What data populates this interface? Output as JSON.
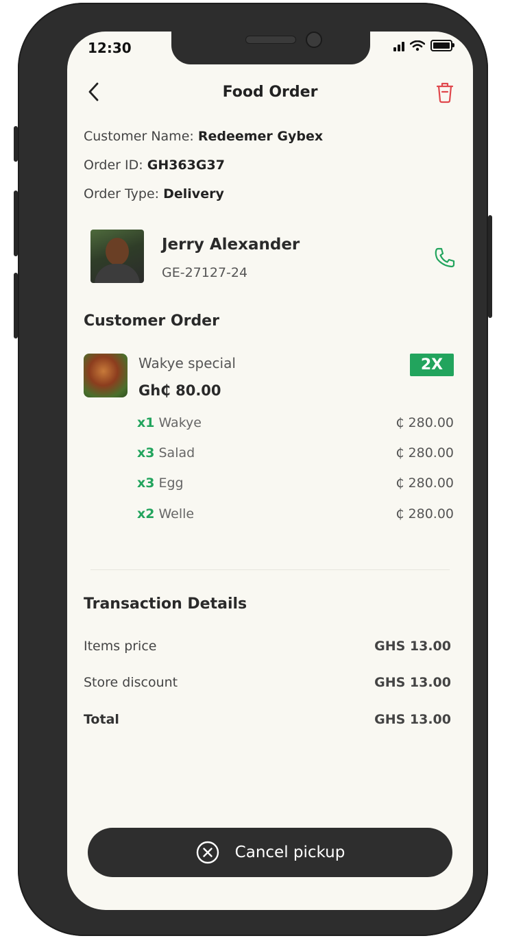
{
  "status_bar": {
    "time": "12:30"
  },
  "header": {
    "title": "Food Order"
  },
  "order_info": {
    "customer_name_label": "Customer Name:",
    "customer_name": "Redeemer Gybex",
    "order_id_label": "Order ID:",
    "order_id": "GH363G37",
    "order_type_label": "Order Type:",
    "order_type": "Delivery"
  },
  "driver": {
    "name": "Jerry Alexander",
    "plate": "GE-27127-24"
  },
  "customer_order": {
    "title": "Customer Order",
    "product": {
      "name": "Wakye special",
      "price": "Gh₵ 80.00",
      "quantity": "2X"
    },
    "items": [
      {
        "qty": "x1",
        "name": "Wakye",
        "price": "₵ 280.00"
      },
      {
        "qty": "x3",
        "name": "Salad",
        "price": "₵ 280.00"
      },
      {
        "qty": "x3",
        "name": "Egg",
        "price": "₵ 280.00"
      },
      {
        "qty": "x2",
        "name": "Welle",
        "price": "₵ 280.00"
      }
    ]
  },
  "transaction": {
    "title": "Transaction Details",
    "rows": [
      {
        "label": "Items price",
        "value": "GHS 13.00"
      },
      {
        "label": "Store discount",
        "value": "GHS 13.00"
      },
      {
        "label": "Total",
        "value": "GHS 13.00"
      }
    ]
  },
  "action": {
    "cancel_label": "Cancel pickup"
  },
  "colors": {
    "accent_green": "#22a45d",
    "danger_red": "#e0474c",
    "button_dark": "#2e2e2e",
    "screen_bg": "#f9f8f2"
  },
  "icons": [
    "back-arrow-icon",
    "trash-icon",
    "phone-icon",
    "close-circle-icon",
    "signal-icon",
    "wifi-icon",
    "battery-icon"
  ]
}
